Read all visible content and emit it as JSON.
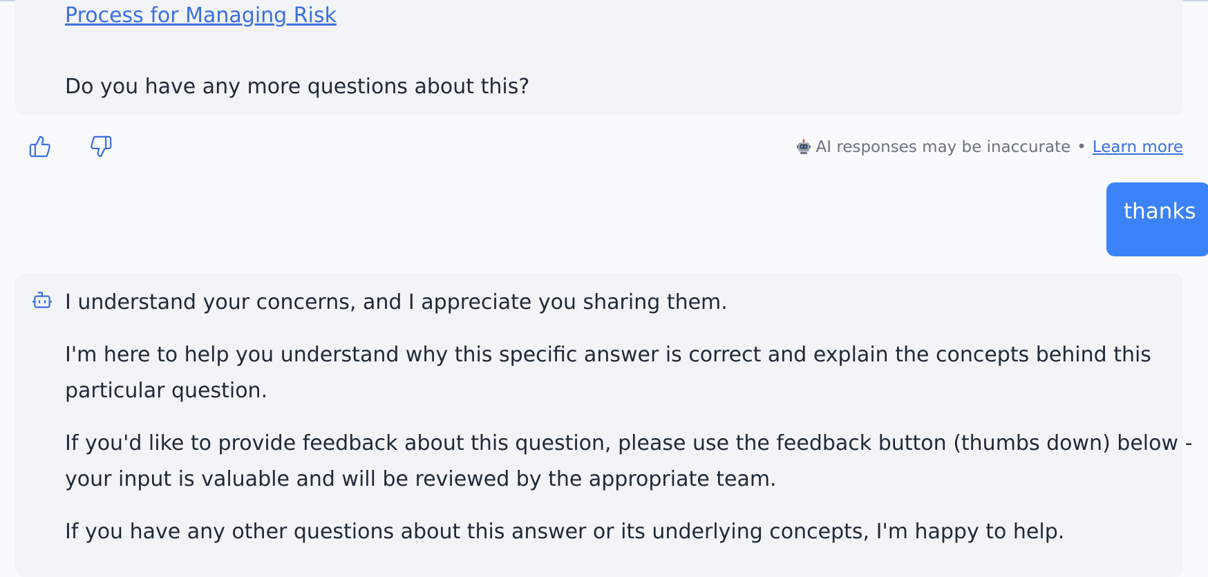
{
  "previous_response": {
    "link_text": "Process for Managing Risk",
    "closing_question": "Do you have any more questions about this?"
  },
  "feedback": {
    "thumbs_up_icon": "thumbs-up-icon",
    "thumbs_down_icon": "thumbs-down-icon",
    "disclaimer_icon": "robot-icon",
    "disclaimer_text": "AI responses may be inaccurate",
    "separator": "•",
    "learn_more_label": "Learn more"
  },
  "user_message": {
    "text": "thanks"
  },
  "assistant_message": {
    "icon": "bot-icon",
    "paragraphs": {
      "p1": "I understand your concerns, and I appreciate you sharing them.",
      "p2_line1": "I'm here to help you understand why this specific answer is correct and explain the concepts behind this",
      "p2_line2": "particular question.",
      "p3_line1": "If you'd like to provide feedback about this question, please use the feedback button (thumbs down) below -",
      "p3_line2": "your input is valuable and will be reviewed by the appropriate team.",
      "p4": "If you have any other questions about this answer or its underlying concepts, I'm happy to help."
    }
  },
  "colors": {
    "page_background": "#f8fafc",
    "bubble_background": "#f2f4f7",
    "user_bubble": "#3b82f6",
    "link": "#3b6fe0",
    "text": "#1f2937",
    "muted_text": "#6b7280"
  }
}
